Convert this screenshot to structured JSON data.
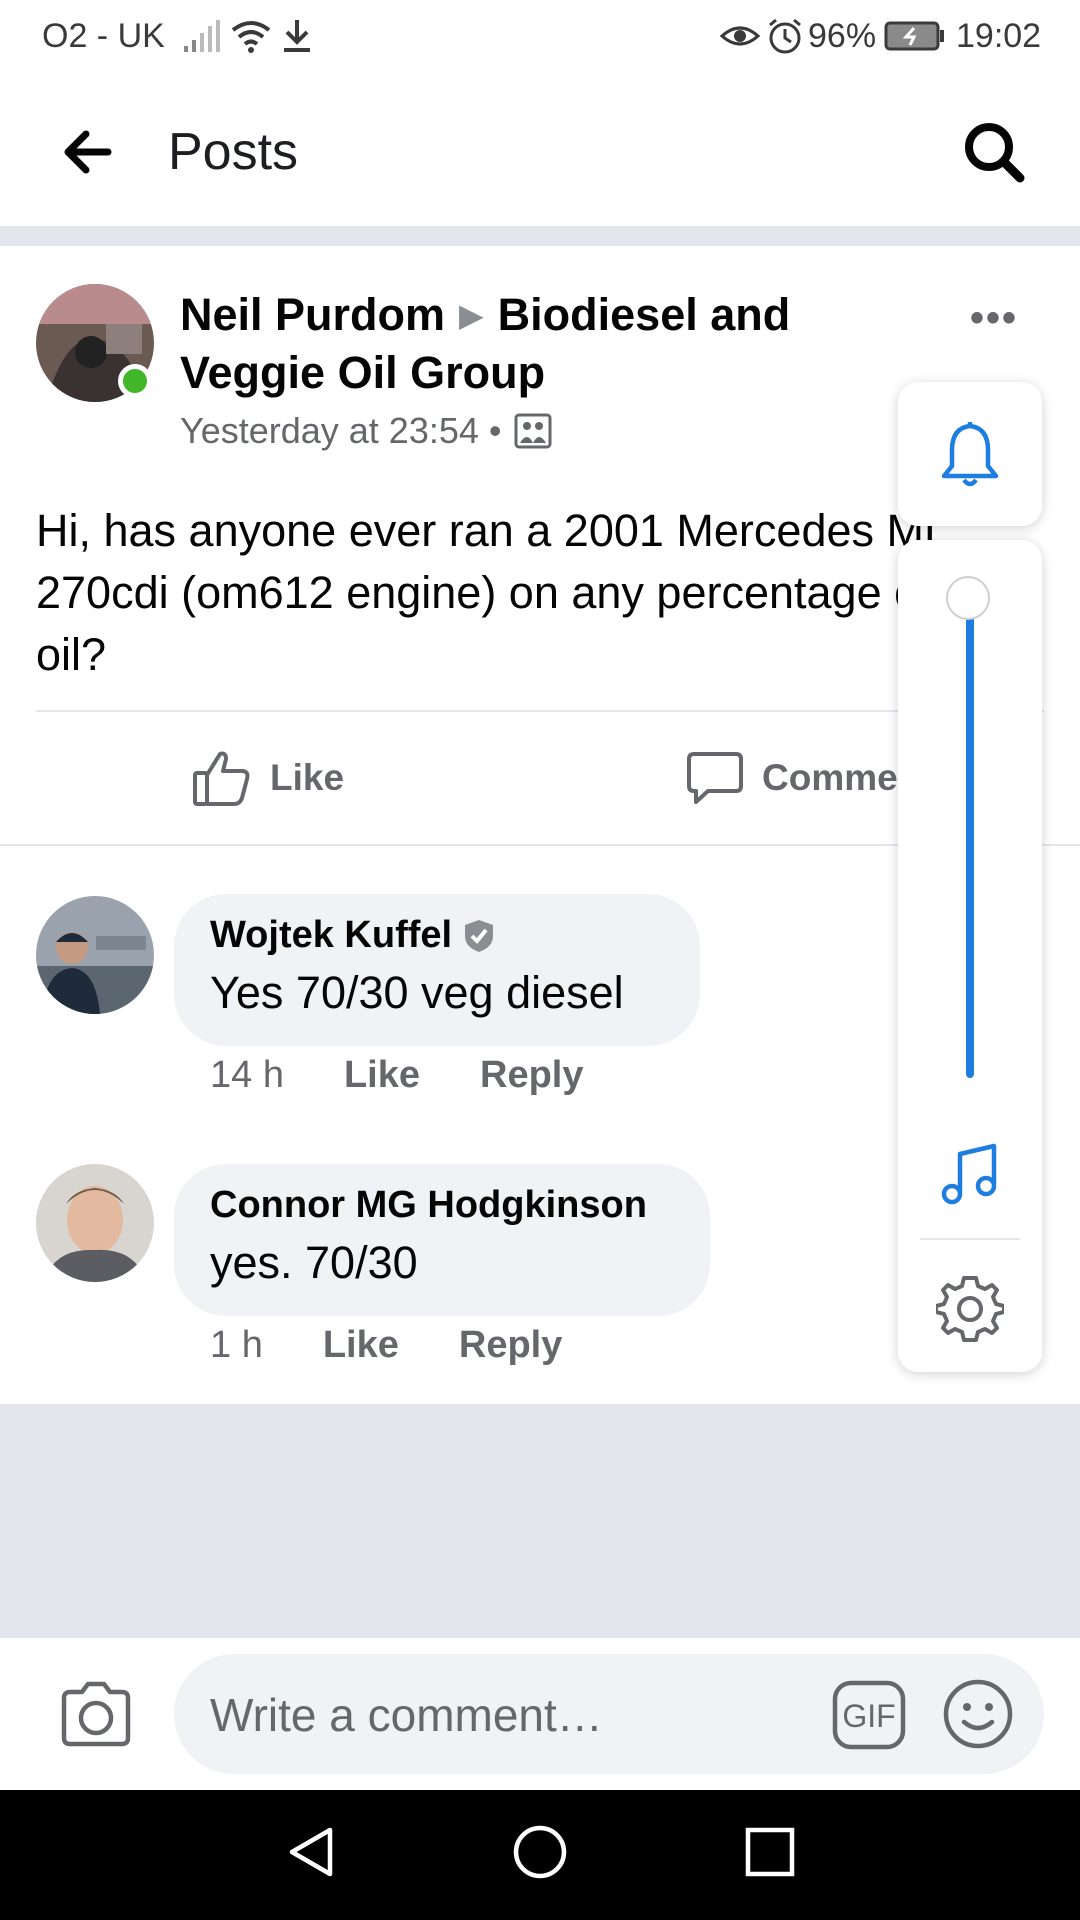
{
  "status_bar": {
    "carrier": "O2 - UK",
    "battery": "96%",
    "time": "19:02"
  },
  "header": {
    "title": "Posts"
  },
  "post": {
    "author": "Neil Purdom",
    "group": "Biodiesel and Veggie Oil Group",
    "timestamp": "Yesterday at 23:54 •",
    "text": "Hi, has anyone ever ran a 2001 Mercedes ML 270cdi (om612 engine) on any percentage of veg oil?",
    "actions": {
      "like": "Like",
      "comment": "Comment"
    }
  },
  "comments": [
    {
      "author": "Wojtek Kuffel",
      "text": "Yes 70/30 veg diesel",
      "time": "14 h",
      "like": "Like",
      "reply": "Reply"
    },
    {
      "author": "Connor MG Hodgkinson",
      "text": "yes. 70/30",
      "time": "1 h",
      "like": "Like",
      "reply": "Reply"
    }
  ],
  "composer": {
    "placeholder": "Write a comment…"
  },
  "volume_overlay": {
    "level": 1.0
  },
  "colors": {
    "accent": "#1e7ee0",
    "online": "#42b72a",
    "secondary_text": "#65676b",
    "bubble": "#f0f2f5"
  }
}
